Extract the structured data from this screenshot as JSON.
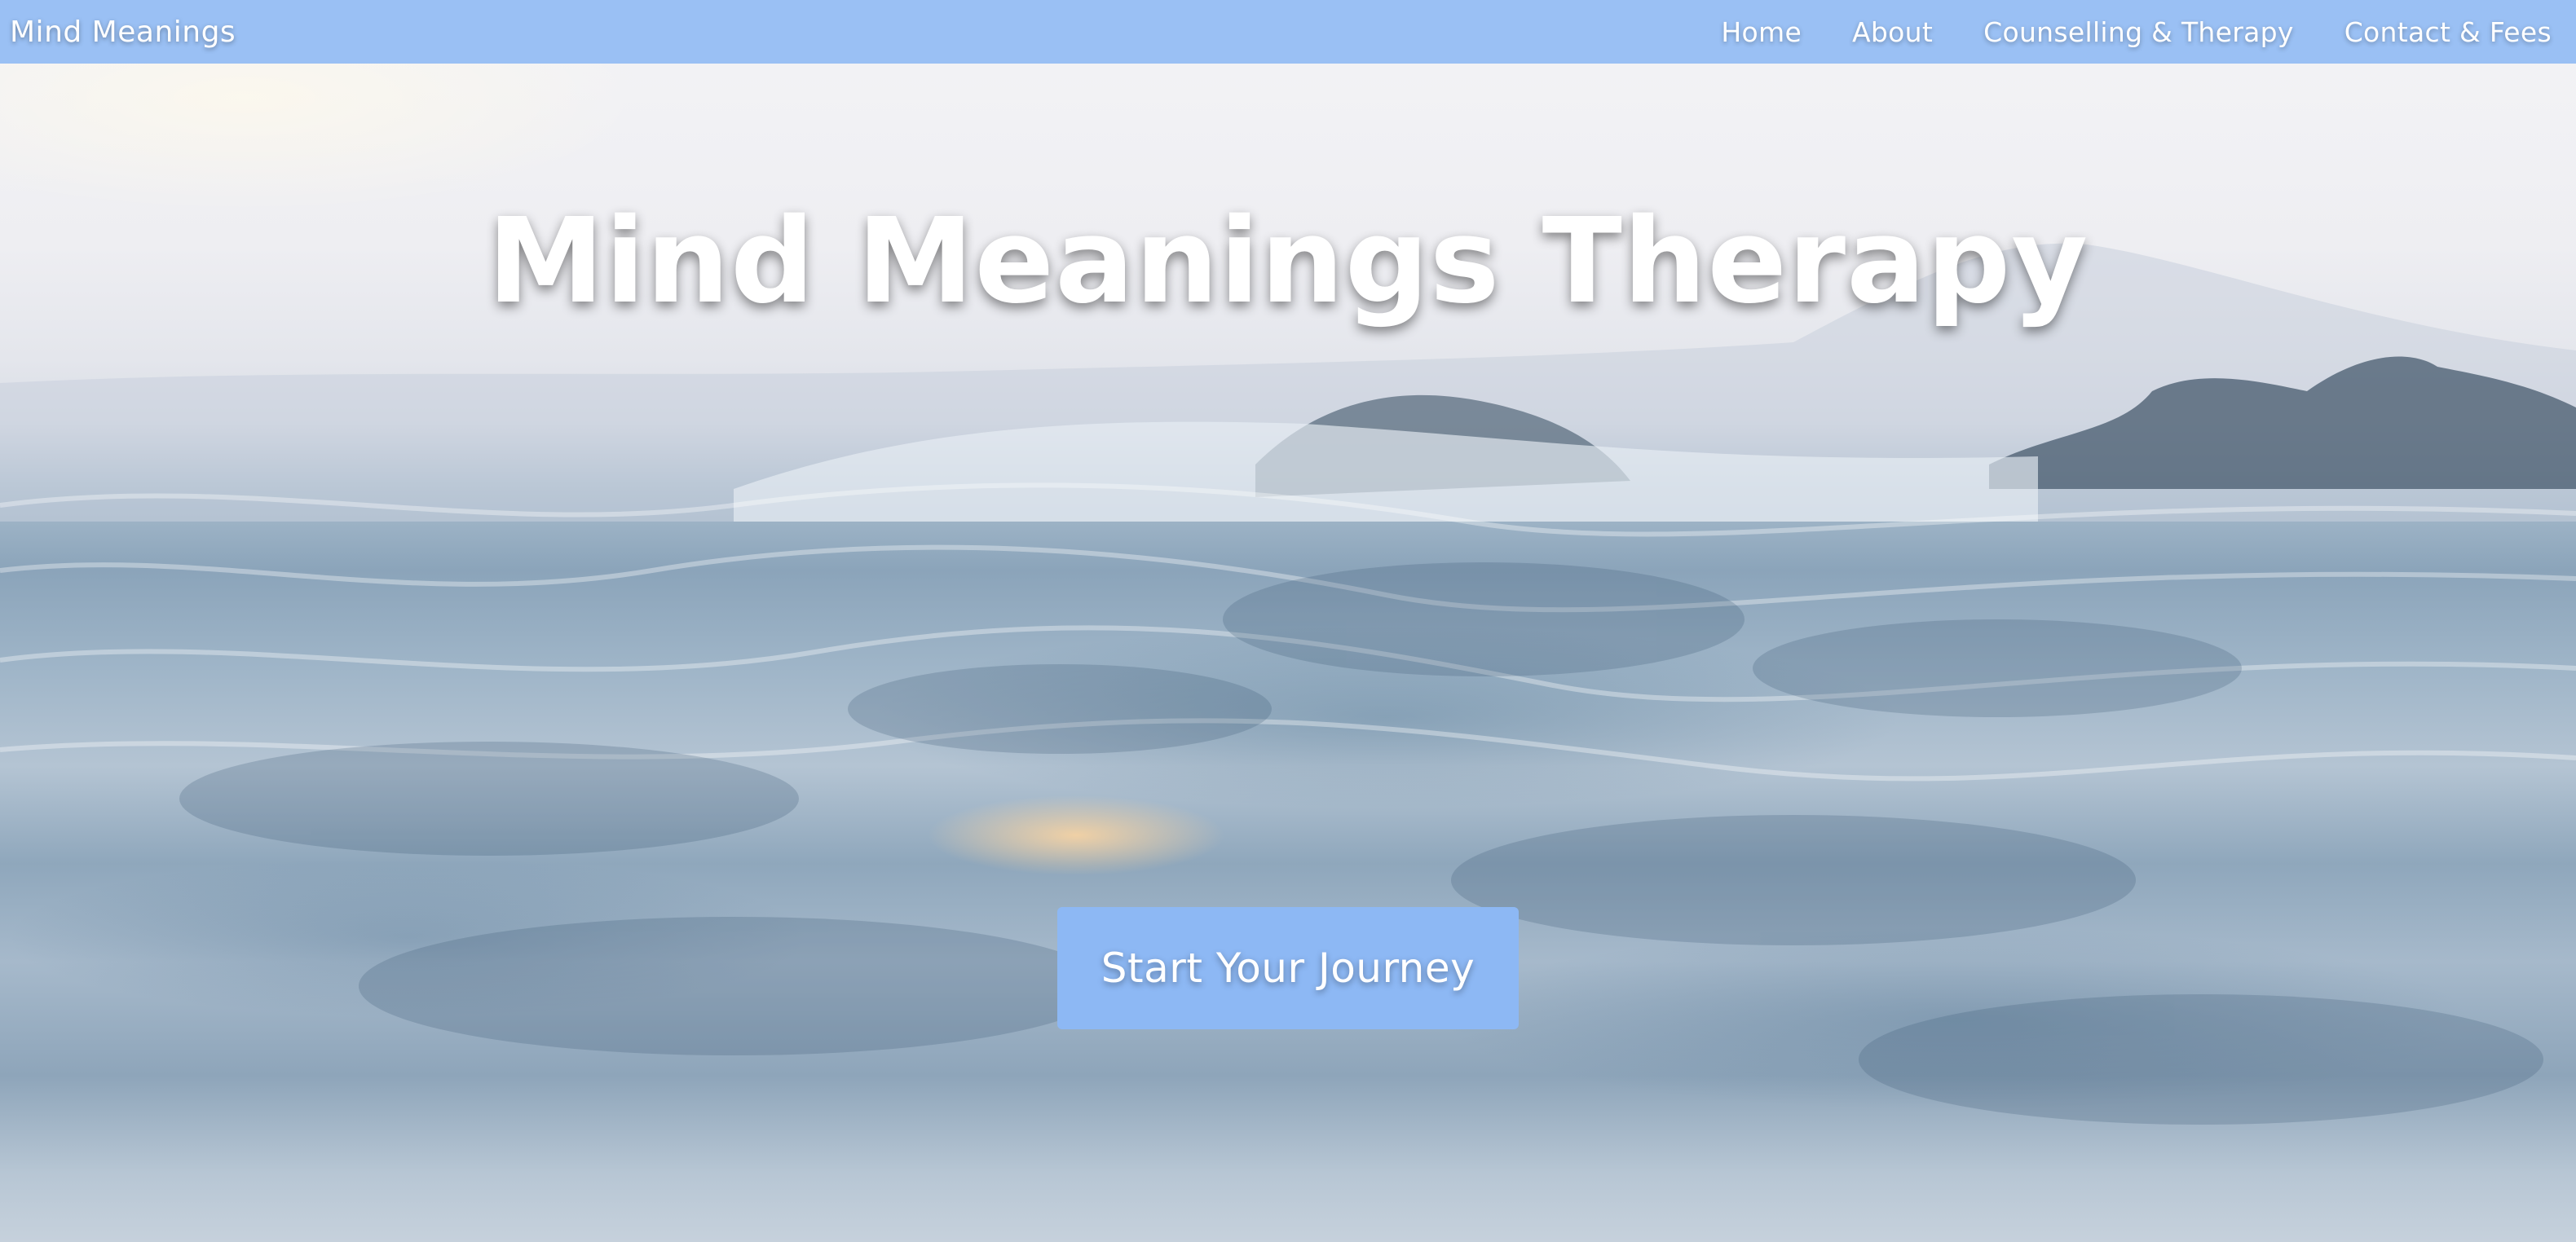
{
  "navbar": {
    "brand": "Mind Meanings",
    "links": [
      {
        "label": "Home"
      },
      {
        "label": "About"
      },
      {
        "label": "Counselling & Therapy"
      },
      {
        "label": "Contact & Fees"
      }
    ],
    "background_color": "#9ac0f4"
  },
  "hero": {
    "title": "Mind Meanings Therapy",
    "cta_label": "Start Your Journey",
    "cta_color": "#8db8f4",
    "background_description_color": "#8ba4ba"
  }
}
